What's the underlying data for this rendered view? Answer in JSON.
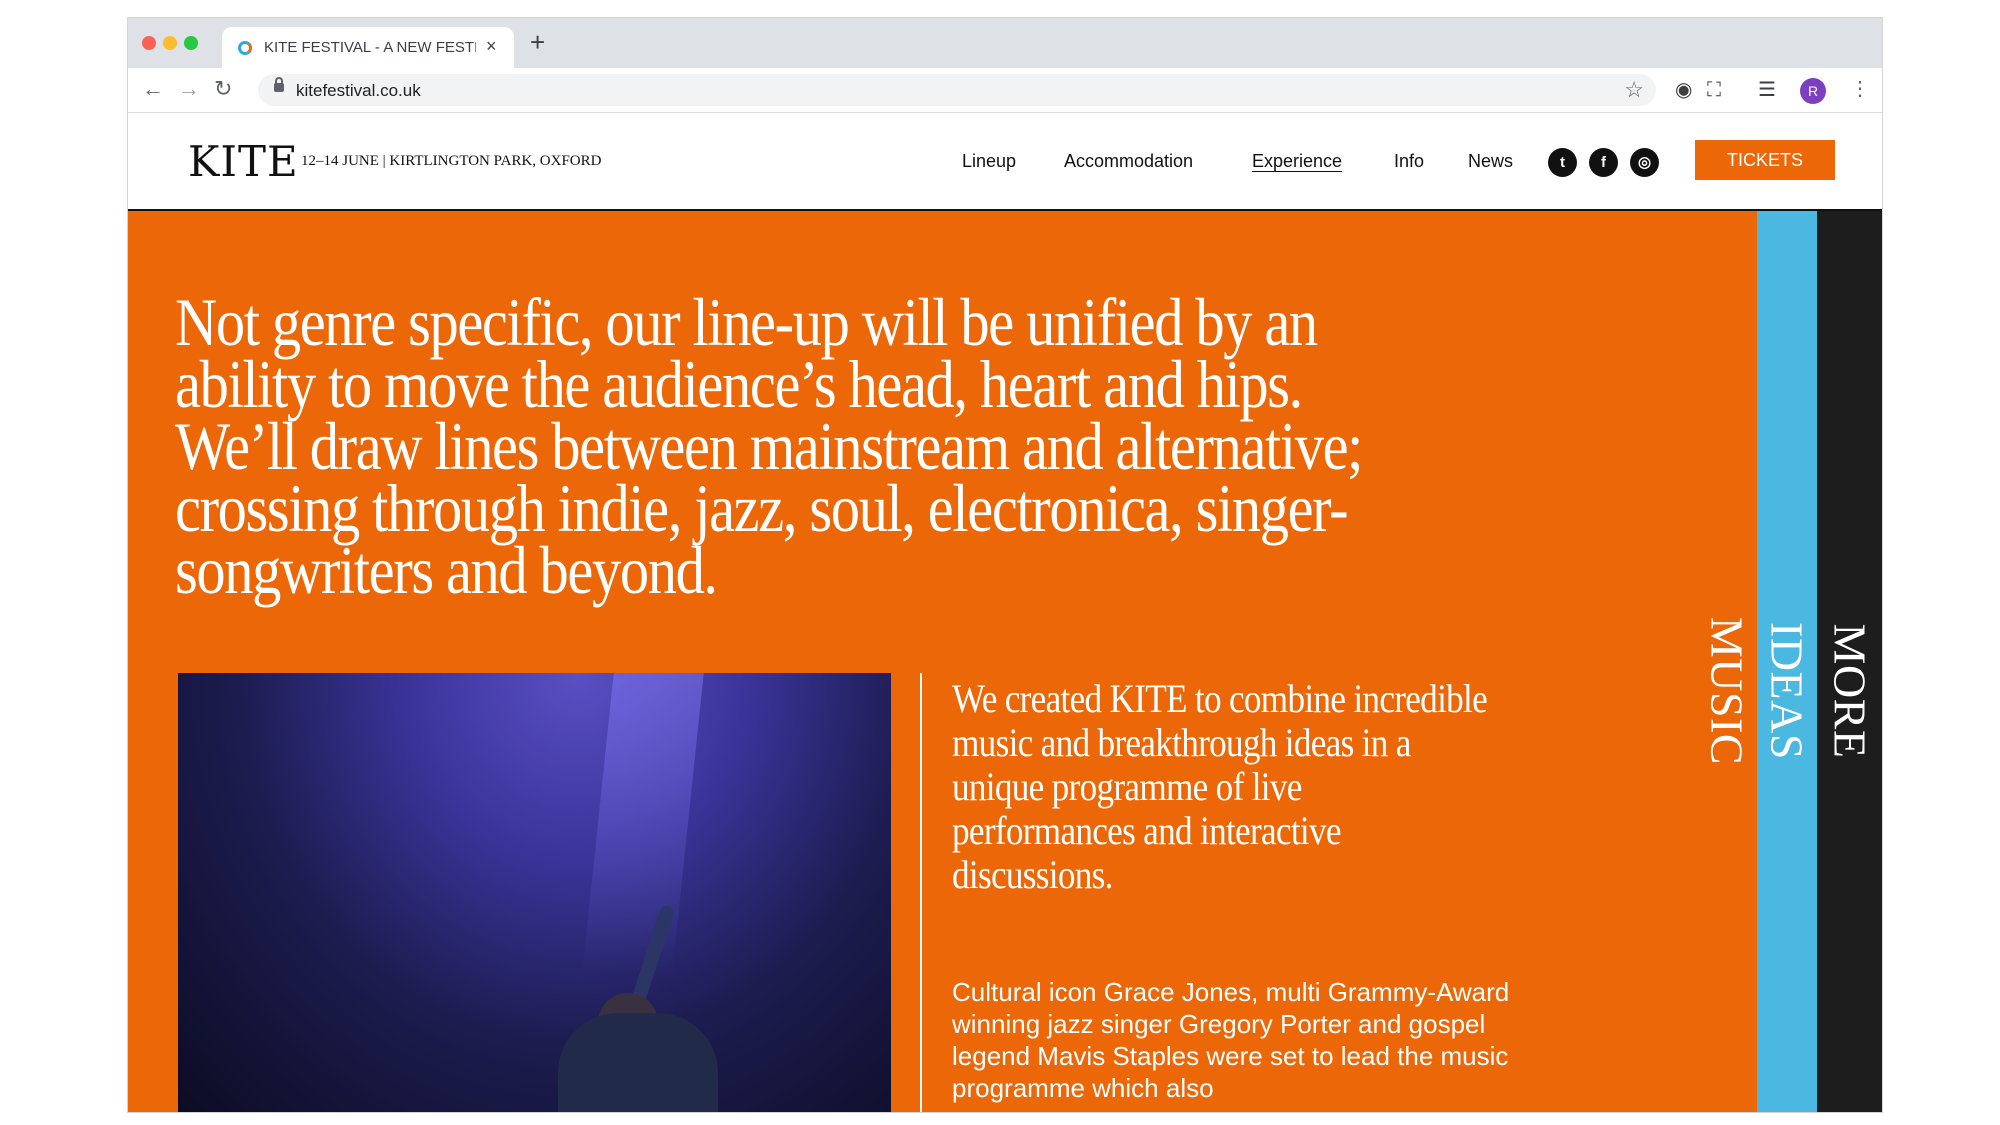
{
  "browser": {
    "tab_title": "KITE FESTIVAL - A NEW FESTIVAL",
    "tab_close": "×",
    "new_tab": "+",
    "url": "kitefestival.co.uk",
    "back": "←",
    "forward": "→",
    "reload": "↻",
    "star": "☆",
    "avatar_letter": "R",
    "menu": "⋮",
    "extensions": [
      "ghost-extension-icon",
      "screenshot-icon",
      "reading-list-icon"
    ]
  },
  "site": {
    "logo": "KITE",
    "dates": "12–14 JUNE  |  KIRTLINGTON PARK, OXFORD",
    "nav": [
      "Lineup",
      "Accommodation",
      "Experience",
      "Info",
      "News"
    ],
    "active_nav": "Experience",
    "social": [
      "twitter-icon",
      "facebook-icon",
      "instagram-icon"
    ],
    "tickets": "TICKETS"
  },
  "content": {
    "hero": "Not genre specific, our line-up will be unified by an ability to move the audience’s head, heart and hips. We’ll draw lines between mainstream and alternative; crossing through indie, jazz, soul, electronica, singer-songwriters and beyond.",
    "lead": "We created KITE to combine incredible music and breakthrough ideas in a unique programme of live performances and interactive discussions.",
    "body": "Cultural icon Grace Jones, multi Grammy-Award winning jazz singer Gregory Porter and gospel legend Mavis Staples were set to lead the music programme which also"
  },
  "side_tabs": {
    "music": "MUSIC",
    "ideas": "IDEAS",
    "more": "MORE"
  },
  "colors": {
    "orange": "#ec6708",
    "blue": "#4ab8e0",
    "black": "#1d1d1d"
  }
}
